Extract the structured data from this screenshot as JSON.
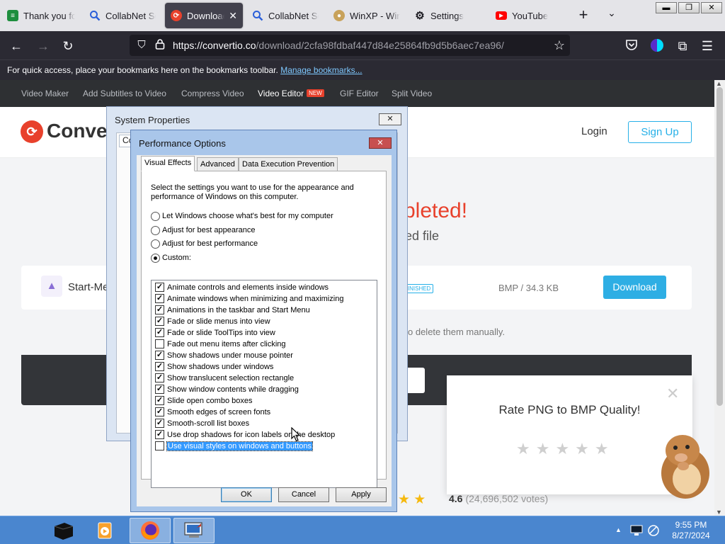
{
  "browser": {
    "tabs": [
      {
        "title": "Thank you for",
        "icon": "sheets-icon",
        "color": "#1e8e3e"
      },
      {
        "title": "CollabNet Se",
        "icon": "search-icon",
        "color": "#2b5fd9"
      },
      {
        "title": "Download",
        "icon": "convertio-icon",
        "color": "#e8412c",
        "active": true
      },
      {
        "title": "CollabNet Se",
        "icon": "search-icon",
        "color": "#2b5fd9"
      },
      {
        "title": "WinXP - Win",
        "icon": "doge-icon",
        "color": "#c8a25a"
      },
      {
        "title": "Settings",
        "icon": "gear-icon",
        "color": "#1c1b22"
      },
      {
        "title": "YouTube",
        "icon": "youtube-icon",
        "color": "#ff0000"
      }
    ],
    "new_tab": "+",
    "tab_list": "⌄",
    "window_controls": {
      "minimize": "▬",
      "maximize": "❐",
      "close": "✕"
    },
    "url_host": "https://convertio.co",
    "url_path": "/download/2cfa98fdbaf447d84e25864fb9d5b6aec7ea96/",
    "bookmarks_text": "For quick access, place your bookmarks here on the bookmarks toolbar.",
    "bookmarks_link": "Manage bookmarks..."
  },
  "site": {
    "nav": [
      "Video Maker",
      "Add Subtitles to Video",
      "Compress Video",
      "Video Editor",
      "GIF Editor",
      "Split Video"
    ],
    "new_badge": "NEW",
    "logo_text": "Convert",
    "login": "Login",
    "signup": "Sign Up",
    "headline_fragment": "pleted!",
    "subline_fragment": "ed file",
    "file_name": "Start-Me",
    "file_status": "FINISHED",
    "file_size": "BMP / 34.3 KB",
    "download_button": "Download",
    "info_fragment": "o delete them manually.",
    "dark_button_fragment": "s",
    "rating_value": "4.6",
    "rating_votes": "(24,696,502 votes)",
    "rate_title": "Rate PNG to BMP Quality!",
    "rate_stars": "★★★★★",
    "page_stars": "★ ★"
  },
  "system_properties": {
    "title": "System Properties",
    "tab_fragment": "Co",
    "close": "✕"
  },
  "performance_options": {
    "title": "Performance Options",
    "close": "✕",
    "tabs": [
      "Visual Effects",
      "Advanced",
      "Data Execution Prevention"
    ],
    "description": "Select the settings you want to use for the appearance and performance of Windows on this computer.",
    "radios": [
      {
        "label": "Let Windows choose what's best for my computer",
        "selected": false
      },
      {
        "label": "Adjust for best appearance",
        "selected": false
      },
      {
        "label": "Adjust for best performance",
        "selected": false
      },
      {
        "label": "Custom:",
        "selected": true
      }
    ],
    "effects": [
      {
        "label": "Animate controls and elements inside windows",
        "checked": true
      },
      {
        "label": "Animate windows when minimizing and maximizing",
        "checked": true
      },
      {
        "label": "Animations in the taskbar and Start Menu",
        "checked": true
      },
      {
        "label": "Fade or slide menus into view",
        "checked": true
      },
      {
        "label": "Fade or slide ToolTips into view",
        "checked": true
      },
      {
        "label": "Fade out menu items after clicking",
        "checked": false
      },
      {
        "label": "Show shadows under mouse pointer",
        "checked": true
      },
      {
        "label": "Show shadows under windows",
        "checked": true
      },
      {
        "label": "Show translucent selection rectangle",
        "checked": true
      },
      {
        "label": "Show window contents while dragging",
        "checked": true
      },
      {
        "label": "Slide open combo boxes",
        "checked": true
      },
      {
        "label": "Smooth edges of screen fonts",
        "checked": true
      },
      {
        "label": "Smooth-scroll list boxes",
        "checked": true
      },
      {
        "label": "Use drop shadows for icon labels on the desktop",
        "checked": true
      },
      {
        "label": "Use visual styles on windows and buttons",
        "checked": false,
        "highlighted": true
      }
    ],
    "buttons": {
      "ok": "OK",
      "cancel": "Cancel",
      "apply": "Apply"
    }
  },
  "taskbar": {
    "clock_time": "9:55 PM",
    "clock_date": "8/27/2024",
    "tray_arrow": "▲"
  },
  "colors": {
    "accent_red": "#e8412c",
    "accent_blue": "#26b0e8",
    "taskbar": "#4a86cf",
    "highlight": "#3399ff"
  }
}
